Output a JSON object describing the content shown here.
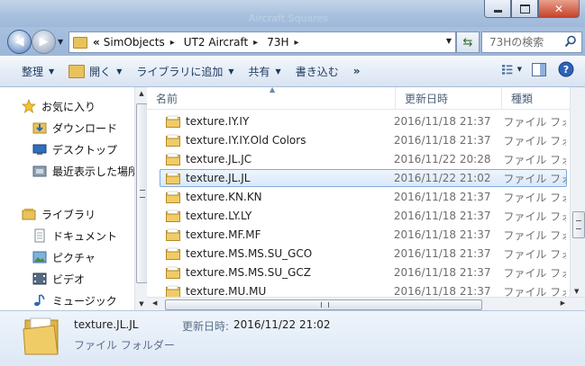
{
  "titlebar": {
    "blurred_text": "Aircraft Squares"
  },
  "address": {
    "overflow": "«",
    "crumbs": [
      "SimObjects",
      "UT2 Aircraft",
      "73H"
    ]
  },
  "search": {
    "placeholder": "73Hの検索"
  },
  "toolbar": {
    "organize": "整理",
    "open": "開く",
    "library": "ライブラリに追加",
    "share": "共有",
    "burn": "書き込む",
    "more": "»"
  },
  "nav": {
    "favorites": "お気に入り",
    "downloads": "ダウンロード",
    "desktop": "デスクトップ",
    "recent": "最近表示した場所",
    "libraries": "ライブラリ",
    "documents": "ドキュメント",
    "pictures": "ピクチャ",
    "videos": "ビデオ",
    "music": "ミュージック"
  },
  "columns": {
    "name": "名前",
    "date": "更新日時",
    "type": "種類"
  },
  "files": [
    {
      "name": "texture.IY.IY",
      "date": "2016/11/18 21:37",
      "type": "ファイル フォ"
    },
    {
      "name": "texture.IY.IY.Old Colors",
      "date": "2016/11/18 21:37",
      "type": "ファイル フォ"
    },
    {
      "name": "texture.JL.JC",
      "date": "2016/11/22 20:28",
      "type": "ファイル フォ"
    },
    {
      "name": "texture.JL.JL",
      "date": "2016/11/22 21:02",
      "type": "ファイル フォ"
    },
    {
      "name": "texture.KN.KN",
      "date": "2016/11/18 21:37",
      "type": "ファイル フォ"
    },
    {
      "name": "texture.LY.LY",
      "date": "2016/11/18 21:37",
      "type": "ファイル フォ"
    },
    {
      "name": "texture.MF.MF",
      "date": "2016/11/18 21:37",
      "type": "ファイル フォ"
    },
    {
      "name": "texture.MS.MS.SU_GCO",
      "date": "2016/11/18 21:37",
      "type": "ファイル フォ"
    },
    {
      "name": "texture.MS.MS.SU_GCZ",
      "date": "2016/11/18 21:37",
      "type": "ファイル フォ"
    },
    {
      "name": "texture.MU.MU",
      "date": "2016/11/18 21:37",
      "type": "ファイル フォ"
    }
  ],
  "selected_index": 3,
  "details": {
    "name": "texture.JL.JL",
    "modified_label": "更新日時:",
    "modified_value": "2016/11/22 21:02",
    "type": "ファイル フォルダー"
  },
  "colors": {
    "folder": "#e8c25c",
    "selection": "#d9e9fb",
    "chrome": "#a9c1df"
  }
}
